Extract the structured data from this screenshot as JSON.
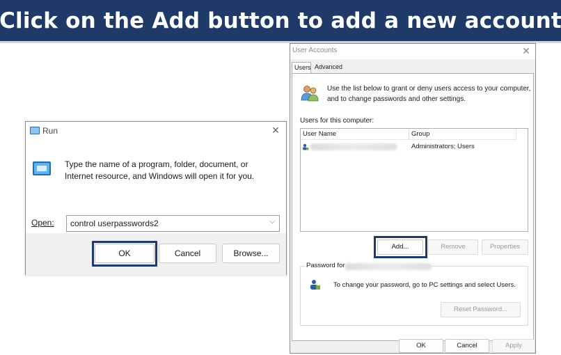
{
  "banner": {
    "text": "Click on the Add button to add a new account"
  },
  "run_dialog": {
    "title": "Run",
    "title_icon": "run-icon",
    "description": "Type the name of a program, folder, document, or Internet resource, and Windows will open it for you.",
    "open_label": "Open:",
    "open_value": "control userpasswords2",
    "ok_label": "OK",
    "cancel_label": "Cancel",
    "browse_label": "Browse..."
  },
  "user_accounts": {
    "title": "User Accounts",
    "tabs": [
      {
        "label": "Users",
        "selected": true
      },
      {
        "label": "Advanced",
        "selected": false
      }
    ],
    "description": "Use the list below to grant or deny users access to your computer, and to change passwords and other settings.",
    "users_label": "Users for this computer:",
    "columns": [
      "User Name",
      "Group"
    ],
    "rows": [
      {
        "group": "Administrators; Users"
      }
    ],
    "add_label": "Add...",
    "remove_label": "Remove",
    "properties_label": "Properties",
    "password_group_label": "Password for",
    "password_text": "To change your password, go to PC settings and select Users.",
    "reset_label": "Reset Password...",
    "ok_label": "OK",
    "cancel_label": "Cancel",
    "apply_label": "Apply"
  },
  "colors": {
    "banner_bg": "#1f3a68",
    "highlight": "#1f3a68"
  }
}
